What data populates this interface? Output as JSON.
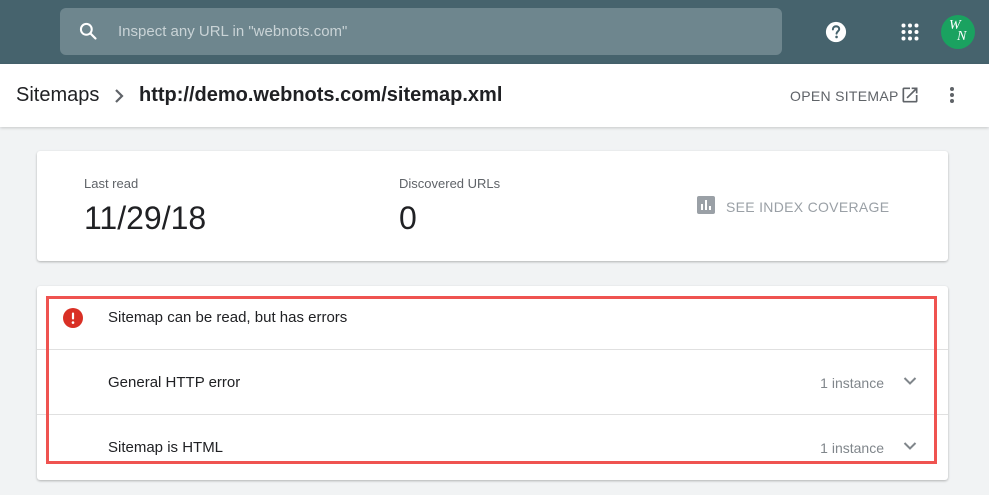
{
  "search": {
    "placeholder": "Inspect any URL in \"webnots.com\""
  },
  "top_icons": [
    "search-icon",
    "help-icon",
    "apps-grid-icon"
  ],
  "avatar": {
    "letters": [
      "W",
      "N"
    ],
    "color": "#1aa260"
  },
  "breadcrumb": {
    "root": "Sitemaps",
    "current": "http://demo.webnots.com/sitemap.xml"
  },
  "header_actions": {
    "open_sitemap": "OPEN SITEMAP"
  },
  "stats": {
    "last_read_label": "Last read",
    "last_read_value": "11/29/18",
    "discovered_label": "Discovered URLs",
    "discovered_value": "0",
    "coverage_link": "SEE INDEX COVERAGE"
  },
  "issues": {
    "summary": "Sitemap can be read, but has errors",
    "rows": [
      {
        "title": "General HTTP error",
        "count": "1 instance"
      },
      {
        "title": "Sitemap is HTML",
        "count": "1 instance"
      }
    ]
  },
  "colors": {
    "topbar": "#46636d",
    "error": "#d93025",
    "highlight": "#ef5350",
    "avatar": "#1aa260"
  }
}
